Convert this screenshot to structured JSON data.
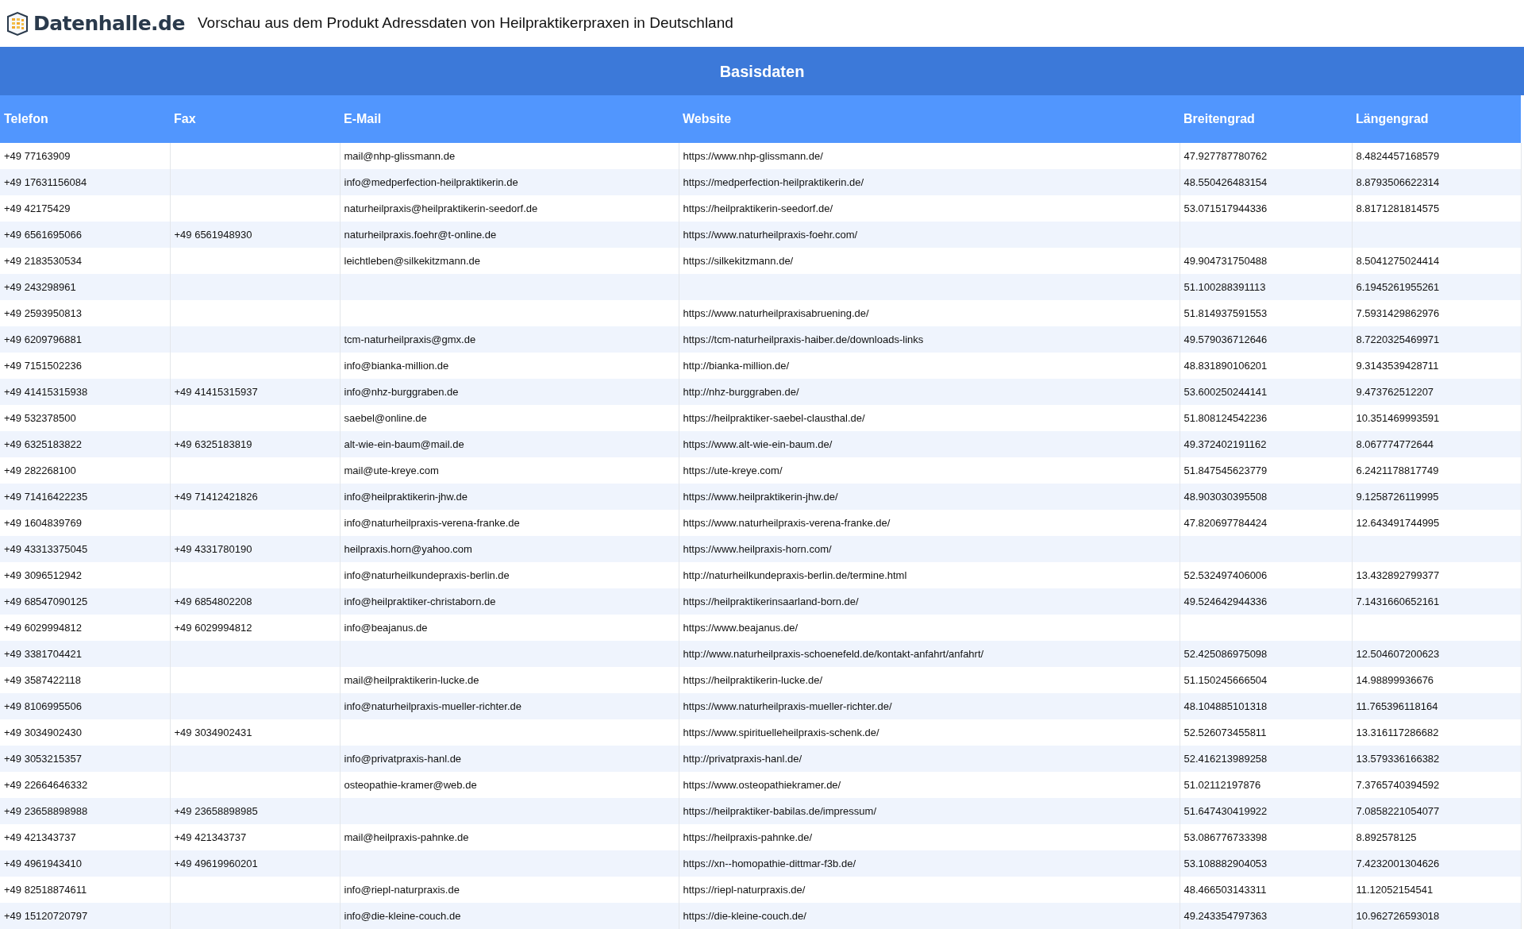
{
  "header": {
    "logo_text": "Datenhalle.de",
    "title": "Vorschau aus dem Produkt Adressdaten von Heilpraktikerpraxen in Deutschland"
  },
  "table": {
    "group_title": "Basisdaten",
    "columns": [
      "Telefon",
      "Fax",
      "E-Mail",
      "Website",
      "Breitengrad",
      "Längengrad"
    ],
    "rows": [
      [
        "+49 77163909",
        null,
        "mail@nhp-glissmann.de",
        "https://www.nhp-glissmann.de/",
        "47.927787780762",
        "8.4824457168579"
      ],
      [
        "+49 17631156084",
        null,
        "info@medperfection-heilpraktikerin.de",
        "https://medperfection-heilpraktikerin.de/",
        "48.550426483154",
        "8.8793506622314"
      ],
      [
        "+49 42175429",
        null,
        "naturheilpraxis@heilpraktikerin-seedorf.de",
        "https://heilpraktikerin-seedorf.de/",
        "53.071517944336",
        "8.8171281814575"
      ],
      [
        "+49 6561695066",
        "+49 6561948930",
        "naturheilpraxis.foehr@t-online.de",
        "https://www.naturheilpraxis-foehr.com/",
        null,
        null
      ],
      [
        "+49 2183530534",
        null,
        "leichtleben@silkekitzmann.de",
        "https://silkekitzmann.de/",
        "49.904731750488",
        "8.5041275024414"
      ],
      [
        "+49 243298961",
        null,
        null,
        null,
        "51.100288391113",
        "6.1945261955261"
      ],
      [
        "+49 2593950813",
        null,
        null,
        "https://www.naturheilpraxisabruening.de/",
        "51.814937591553",
        "7.5931429862976"
      ],
      [
        "+49 6209796881",
        null,
        "tcm-naturheilpraxis@gmx.de",
        "https://tcm-naturheilpraxis-haiber.de/downloads-links",
        "49.579036712646",
        "8.7220325469971"
      ],
      [
        "+49 7151502236",
        null,
        "info@bianka-million.de",
        "http://bianka-million.de/",
        "48.831890106201",
        "9.3143539428711"
      ],
      [
        "+49 41415315938",
        "+49 41415315937",
        "info@nhz-burggraben.de",
        "http://nhz-burggraben.de/",
        "53.600250244141",
        "9.473762512207"
      ],
      [
        "+49 532378500",
        null,
        "saebel@online.de",
        "https://heilpraktiker-saebel-clausthal.de/",
        "51.808124542236",
        "10.351469993591"
      ],
      [
        "+49 6325183822",
        "+49 6325183819",
        "alt-wie-ein-baum@mail.de",
        "https://www.alt-wie-ein-baum.de/",
        "49.372402191162",
        "8.067774772644"
      ],
      [
        "+49 282268100",
        null,
        "mail@ute-kreye.com",
        "https://ute-kreye.com/",
        "51.847545623779",
        "6.2421178817749"
      ],
      [
        "+49 71416422235",
        "+49 71412421826",
        "info@heilpraktikerin-jhw.de",
        "https://www.heilpraktikerin-jhw.de/",
        "48.903030395508",
        "9.1258726119995"
      ],
      [
        "+49 1604839769",
        null,
        "info@naturheilpraxis-verena-franke.de",
        "https://www.naturheilpraxis-verena-franke.de/",
        "47.820697784424",
        "12.643491744995"
      ],
      [
        "+49 43313375045",
        "+49 4331780190",
        "heilpraxis.horn@yahoo.com",
        "https://www.heilpraxis-horn.com/",
        null,
        null
      ],
      [
        "+49 3096512942",
        null,
        "info@naturheilkundepraxis-berlin.de",
        "http://naturheilkundepraxis-berlin.de/termine.html",
        "52.532497406006",
        "13.432892799377"
      ],
      [
        "+49 68547090125",
        "+49 6854802208",
        "info@heilpraktiker-christaborn.de",
        "https://heilpraktikerinsaarland-born.de/",
        "49.524642944336",
        "7.1431660652161"
      ],
      [
        "+49 6029994812",
        "+49 6029994812",
        "info@beajanus.de",
        "https://www.beajanus.de/",
        null,
        null
      ],
      [
        "+49 3381704421",
        null,
        null,
        "http://www.naturheilpraxis-schoenefeld.de/kontakt-anfahrt/anfahrt/",
        "52.425086975098",
        "12.504607200623"
      ],
      [
        "+49 3587422118",
        null,
        "mail@heilpraktikerin-lucke.de",
        "https://heilpraktikerin-lucke.de/",
        "51.150245666504",
        "14.98899936676"
      ],
      [
        "+49 8106995506",
        null,
        "info@naturheilpraxis-mueller-richter.de",
        "https://www.naturheilpraxis-mueller-richter.de/",
        "48.104885101318",
        "11.765396118164"
      ],
      [
        "+49 3034902430",
        "+49 3034902431",
        null,
        "https://www.spirituelleheilpraxis-schenk.de/",
        "52.526073455811",
        "13.316117286682"
      ],
      [
        "+49 3053215357",
        null,
        "info@privatpraxis-hanl.de",
        "http://privatpraxis-hanl.de/",
        "52.416213989258",
        "13.579336166382"
      ],
      [
        "+49 22664646332",
        null,
        "osteopathie-kramer@web.de",
        "https://www.osteopathiekramer.de/",
        "51.02112197876",
        "7.3765740394592"
      ],
      [
        "+49 23658898988",
        "+49 23658898985",
        null,
        "https://heilpraktiker-babilas.de/impressum/",
        "51.647430419922",
        "7.0858221054077"
      ],
      [
        "+49 421343737",
        "+49 421343737",
        "mail@heilpraxis-pahnke.de",
        "https://heilpraxis-pahnke.de/",
        "53.086776733398",
        "8.892578125"
      ],
      [
        "+49 4961943410",
        "+49 49619960201",
        null,
        "https://xn--homopathie-dittmar-f3b.de/",
        "53.108882904053",
        "7.4232001304626"
      ],
      [
        "+49 82518874611",
        null,
        "info@riepl-naturpraxis.de",
        "https://riepl-naturpraxis.de/",
        "48.466503143311",
        "11.12052154541"
      ],
      [
        "+49 15120720797",
        null,
        "info@die-kleine-couch.de",
        "https://die-kleine-couch.de/",
        "49.243354797363",
        "10.962726593018"
      ]
    ]
  }
}
